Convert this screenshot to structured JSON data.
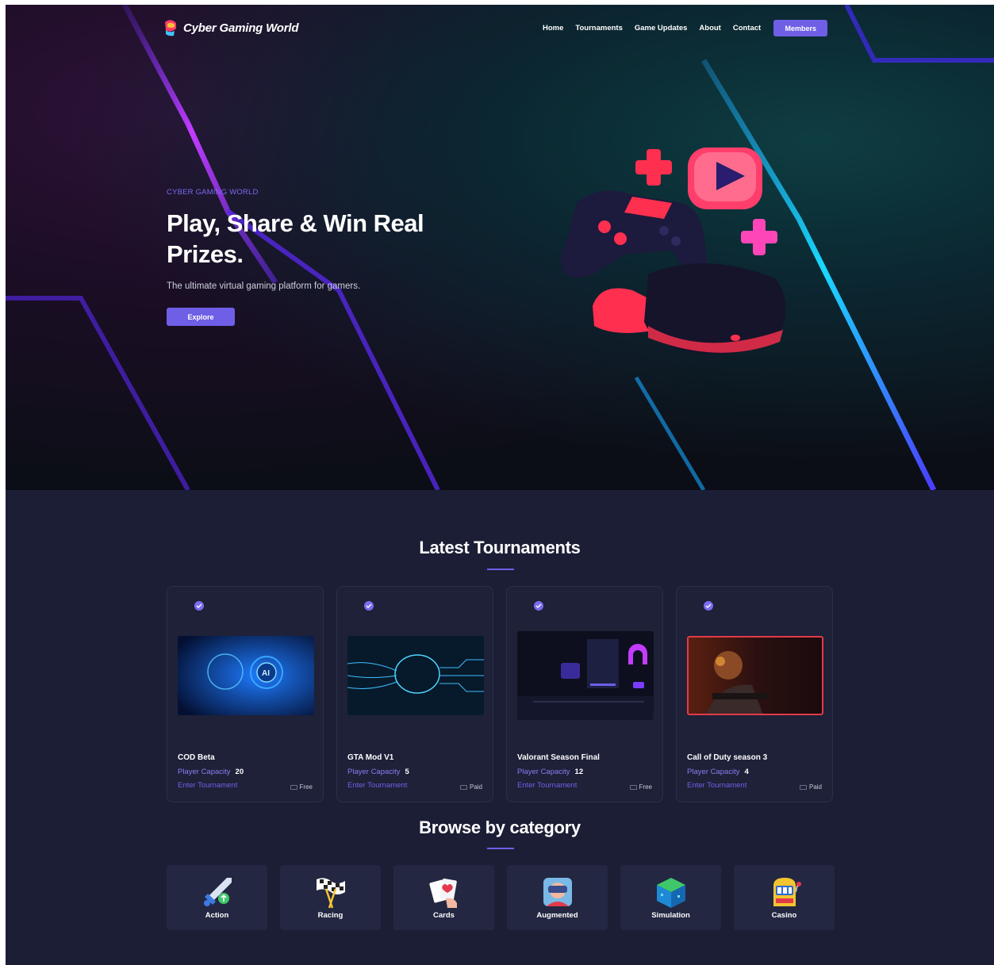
{
  "brand": {
    "name": "Cyber Gaming World"
  },
  "nav": {
    "items": [
      "Home",
      "Tournaments",
      "Game Updates",
      "About",
      "Contact"
    ],
    "members_label": "Members"
  },
  "hero": {
    "eyebrow": "CYBER GAMING WORLD",
    "headline": "Play, Share & Win Real Prizes.",
    "subtitle": "The ultimate virtual gaming platform for gamers.",
    "cta_label": "Explore"
  },
  "tournaments": {
    "title": "Latest Tournaments",
    "capacity_label": "Player Capacity",
    "enter_label": "Enter Tournament",
    "items": [
      {
        "name": "COD Beta",
        "capacity": "20",
        "fee": "Free"
      },
      {
        "name": "GTA Mod V1",
        "capacity": "5",
        "fee": "Paid"
      },
      {
        "name": "Valorant Season Final",
        "capacity": "12",
        "fee": "Free"
      },
      {
        "name": "Call of Duty season 3",
        "capacity": "4",
        "fee": "Paid"
      }
    ]
  },
  "categories": {
    "title": "Browse by category",
    "items": [
      "Action",
      "Racing",
      "Cards",
      "Augmented",
      "Simulation",
      "Casino"
    ]
  },
  "colors": {
    "accent": "#6e5fe6",
    "background": "#1b1e35",
    "card": "#1e2138"
  }
}
